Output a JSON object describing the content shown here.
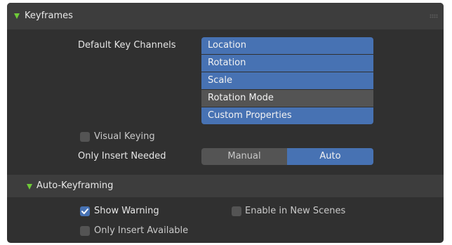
{
  "panel": {
    "title": "Keyframes"
  },
  "default_key_channels": {
    "label": "Default Key Channels",
    "options": [
      {
        "label": "Location",
        "selected": true
      },
      {
        "label": "Rotation",
        "selected": true
      },
      {
        "label": "Scale",
        "selected": true
      },
      {
        "label": "Rotation Mode",
        "selected": false
      },
      {
        "label": "Custom Properties",
        "selected": true
      }
    ]
  },
  "visual_keying": {
    "label": "Visual Keying",
    "checked": false
  },
  "only_insert_needed": {
    "label": "Only Insert Needed",
    "options": [
      "Manual",
      "Auto"
    ],
    "selected": "Auto"
  },
  "auto_keyframing": {
    "title": "Auto-Keyframing",
    "show_warning": {
      "label": "Show Warning",
      "checked": true
    },
    "enable_in_new_scenes": {
      "label": "Enable in New Scenes",
      "checked": false
    },
    "only_insert_available": {
      "label": "Only Insert Available",
      "checked": false
    }
  },
  "colors": {
    "panel_bg": "#303030",
    "header_bg": "#3d3d3d",
    "accent": "#4772b3",
    "widget_bg": "#545454",
    "triangle": "#6fca38"
  },
  "icons": [
    "disclosure-triangle-icon",
    "drag-grip-icon",
    "checkmark-icon"
  ]
}
